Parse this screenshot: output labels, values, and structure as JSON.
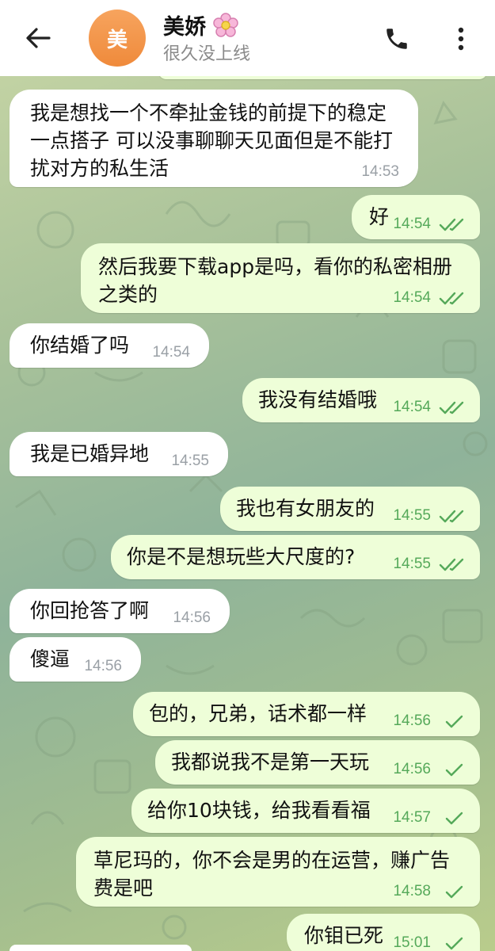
{
  "header": {
    "back_label": "←",
    "avatar_letter": "美",
    "contact_name": "美娇",
    "status": "很久没上线"
  },
  "messages": [
    {
      "direction": "in",
      "text": "我是想找一个不牵扯金钱的前提下的稳定一点搭子  可以没事聊聊天见面但是不能打扰对方的私生活",
      "time": "14:53"
    },
    {
      "direction": "out",
      "text": "好",
      "time": "14:54",
      "status": "read"
    },
    {
      "direction": "out",
      "text": "然后我要下载app是吗，看你的私密相册之类的",
      "time": "14:54",
      "status": "read"
    },
    {
      "direction": "in",
      "text": "你结婚了吗",
      "time": "14:54"
    },
    {
      "direction": "out",
      "text": "我没有结婚哦",
      "time": "14:54",
      "status": "read"
    },
    {
      "direction": "in",
      "text": "我是已婚异地",
      "time": "14:55"
    },
    {
      "direction": "out",
      "text": "我也有女朋友的",
      "time": "14:55",
      "status": "read"
    },
    {
      "direction": "out",
      "text": "你是不是想玩些大尺度的?",
      "time": "14:55",
      "status": "read"
    },
    {
      "direction": "in",
      "text": "你回抢答了啊",
      "time": "14:56"
    },
    {
      "direction": "in",
      "text": "傻逼",
      "time": "14:56"
    },
    {
      "direction": "out",
      "text": "包的，兄弟，话术都一样",
      "time": "14:56",
      "status": "sent"
    },
    {
      "direction": "out",
      "text": "我都说我不是第一天玩",
      "time": "14:56",
      "status": "sent"
    },
    {
      "direction": "out",
      "text": "给你10块钱，给我看看福",
      "time": "14:57",
      "status": "sent"
    },
    {
      "direction": "out",
      "text": "草尼玛的，你不会是男的在运营，赚广告费是吧",
      "time": "14:58",
      "status": "sent"
    },
    {
      "direction": "out",
      "text": "你钼已死",
      "time": "15:01",
      "status": "sent"
    }
  ],
  "colors": {
    "incoming_bubble": "#ffffff",
    "outgoing_bubble": "#eefed8",
    "time_outgoing": "#55a95a",
    "avatar": "#f0913f"
  },
  "icons": {
    "back": "arrow-left-icon",
    "call": "phone-icon",
    "more": "more-vertical-icon",
    "read": "double-check-icon",
    "sent": "single-check-icon"
  }
}
